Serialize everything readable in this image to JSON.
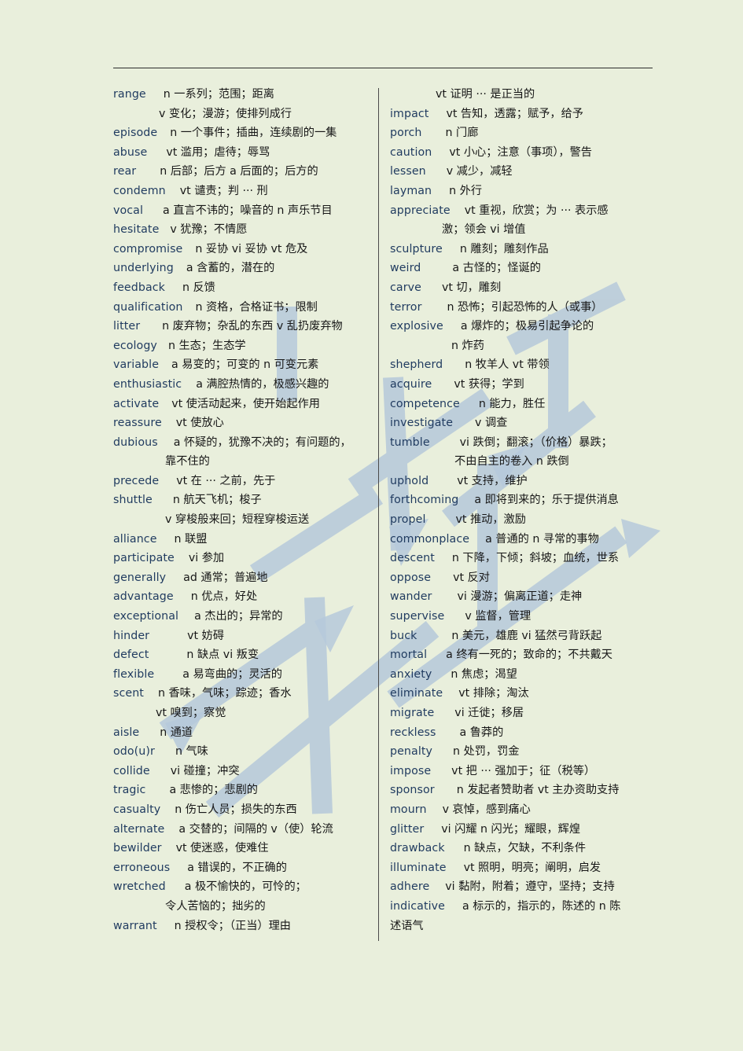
{
  "document": {
    "type": "vocabulary-glossary",
    "background_color": "#e9efdc",
    "text_color": "#171717",
    "headword_color": "#1f3a5f",
    "rule_color": "#2b2b2b",
    "watermark_color": "#b9cbdd",
    "watermark_text": "英语词汇"
  },
  "left_column": [
    {
      "word": "range",
      "gap": 22,
      "def": "n 一系列；范围；距离"
    },
    {
      "word": "",
      "gap": 58,
      "def": "v 变化；漫游；使排列成行"
    },
    {
      "word": "episode",
      "gap": 16,
      "def": "n 一个事件；插曲，连续剧的一集"
    },
    {
      "word": "abuse",
      "gap": 24,
      "def": "vt 滥用；虐待；辱骂"
    },
    {
      "word": "rear",
      "gap": 30,
      "def": "n 后部；后方 a 后面的；后方的"
    },
    {
      "word": "condemn",
      "gap": 18,
      "def": "vt 谴责；判 ··· 刑"
    },
    {
      "word": "vocal",
      "gap": 25,
      "def": "a 直言不讳的；噪音的 n 声乐节目"
    },
    {
      "word": "hesitate",
      "gap": 14,
      "def": "v 犹豫；不情愿"
    },
    {
      "word": "compromise",
      "gap": 16,
      "def": "n 妥协 vi 妥协 vt 危及"
    },
    {
      "word": "underlying",
      "gap": 16,
      "def": "a 含蓄的，潜在的"
    },
    {
      "word": "feedback",
      "gap": 22,
      "def": "n 反馈"
    },
    {
      "word": "qualification",
      "gap": 16,
      "def": "n 资格，合格证书；限制"
    },
    {
      "word": "litter",
      "gap": 28,
      "def": "n 废弃物；杂乱的东西 v 乱扔废弃物"
    },
    {
      "word": "ecology",
      "gap": 14,
      "def": "n 生态；生态学"
    },
    {
      "word": "variable",
      "gap": 16,
      "def": "a 易变的；可变的 n 可变元素"
    },
    {
      "word": "enthusiastic",
      "gap": 18,
      "def": "a 满腔热情的，极感兴趣的"
    },
    {
      "word": "activate",
      "gap": 16,
      "def": "vt 使活动起来，使开始起作用"
    },
    {
      "word": "reassure",
      "gap": 18,
      "def": "vt 使放心"
    },
    {
      "word": "dubious",
      "gap": 20,
      "def": "a 怀疑的，犹豫不决的；有问题的，"
    },
    {
      "word": "",
      "gap": 66,
      "def": "靠不住的"
    },
    {
      "word": "precede",
      "gap": 22,
      "def": "vt 在 ··· 之前，先于"
    },
    {
      "word": "shuttle",
      "gap": 26,
      "def": "n 航天飞机；梭子"
    },
    {
      "word": "",
      "gap": 66,
      "def": "v 穿梭般来回；短程穿梭运送"
    },
    {
      "word": "alliance",
      "gap": 22,
      "def": "n 联盟"
    },
    {
      "word": "participate",
      "gap": 18,
      "def": "vi 参加"
    },
    {
      "word": "generally",
      "gap": 22,
      "def": "ad 通常；普遍地"
    },
    {
      "word": "advantage",
      "gap": 22,
      "def": "n 优点，好处"
    },
    {
      "word": "exceptional",
      "gap": 20,
      "def": "a 杰出的；异常的"
    },
    {
      "word": "hinder",
      "gap": 48,
      "def": "vt 妨碍"
    },
    {
      "word": "defect",
      "gap": 48,
      "def": "n 缺点 vi 叛变"
    },
    {
      "word": "flexible",
      "gap": 36,
      "def": "a 易弯曲的；灵活的"
    },
    {
      "word": "scent",
      "gap": 18,
      "def": "n 香味，气味；踪迹；香水"
    },
    {
      "word": "",
      "gap": 54,
      "def": "vt 嗅到；察觉"
    },
    {
      "word": "aisle",
      "gap": 26,
      "def": "n 通道"
    },
    {
      "word": "odo(u)r",
      "gap": 26,
      "def": "n 气味"
    },
    {
      "word": "collide",
      "gap": 26,
      "def": "vi 碰撞；冲突"
    },
    {
      "word": "tragic",
      "gap": 30,
      "def": "a 悲惨的；悲剧的"
    },
    {
      "word": "casualty",
      "gap": 18,
      "def": "n 伤亡人员；损失的东西"
    },
    {
      "word": "alternate",
      "gap": 18,
      "def": "a 交替的；间隔的 v（使）轮流"
    },
    {
      "word": "bewilder",
      "gap": 18,
      "def": "vt 使迷惑，使难住"
    },
    {
      "word": "erroneous",
      "gap": 22,
      "def": "a 错误的，不正确的"
    },
    {
      "word": "wretched",
      "gap": 24,
      "def": "a 极不愉快的，可怜的；"
    },
    {
      "word": "",
      "gap": 66,
      "def": "令人苦恼的；拙劣的"
    },
    {
      "word": "warrant",
      "gap": 22,
      "def": "n 授权令；（正当）理由"
    }
  ],
  "right_column": [
    {
      "word": "",
      "gap": 58,
      "def": "vt 证明 ··· 是正当的"
    },
    {
      "word": "impact",
      "gap": 22,
      "def": "vt 告知，透露；赋予，给予"
    },
    {
      "word": "porch",
      "gap": 30,
      "def": "n 门廊"
    },
    {
      "word": "caution",
      "gap": 22,
      "def": "vt 小心；注意（事项），警告"
    },
    {
      "word": "lessen",
      "gap": 26,
      "def": "v 减少，减轻"
    },
    {
      "word": "layman",
      "gap": 22,
      "def": "n 外行"
    },
    {
      "word": "appreciate",
      "gap": 18,
      "def": "vt 重视，欣赏；为 ··· 表示感"
    },
    {
      "word": "",
      "gap": 66,
      "def": "激；领会 vi 增值"
    },
    {
      "word": "sculpture",
      "gap": 22,
      "def": "n 雕刻；雕刻作品"
    },
    {
      "word": "weird",
      "gap": 40,
      "def": "a 古怪的；怪诞的"
    },
    {
      "word": "carve",
      "gap": 26,
      "def": "vt 切，雕刻"
    },
    {
      "word": "terror",
      "gap": 32,
      "def": "n 恐怖；引起恐怖的人（或事）"
    },
    {
      "word": "explosive",
      "gap": 22,
      "def": "a 爆炸的；极易引起争论的"
    },
    {
      "word": "",
      "gap": 78,
      "def": "n 炸药"
    },
    {
      "word": "shepherd",
      "gap": 28,
      "def": "n 牧羊人 vt 带领"
    },
    {
      "word": "acquire",
      "gap": 28,
      "def": "vt 获得；学到"
    },
    {
      "word": "competence",
      "gap": 24,
      "def": "n 能力，胜任"
    },
    {
      "word": "investigate",
      "gap": 28,
      "def": "v 调查"
    },
    {
      "word": "tumble",
      "gap": 38,
      "def": "vi 跌倒；翻滚；（价格）暴跌；"
    },
    {
      "word": "",
      "gap": 82,
      "def": "不由自主的卷入 n 跌倒"
    },
    {
      "word": "uphold",
      "gap": 36,
      "def": "vt 支持，维护"
    },
    {
      "word": "forthcoming",
      "gap": 20,
      "def": "a 即将到来的；乐于提供消息"
    },
    {
      "word": "propel",
      "gap": 38,
      "def": "vt 推动，激励"
    },
    {
      "word": "commonplace",
      "gap": 20,
      "def": "a 普通的 n 寻常的事物"
    },
    {
      "word": "descent",
      "gap": 22,
      "def": "n 下降，下倾；斜坡；血统，世系"
    },
    {
      "word": "oppose",
      "gap": 28,
      "def": "vt 反对"
    },
    {
      "word": "wander",
      "gap": 32,
      "def": "vi 漫游；偏离正道；走神"
    },
    {
      "word": "supervise",
      "gap": 26,
      "def": "v 监督，管理"
    },
    {
      "word": "buck",
      "gap": 44,
      "def": "n 美元，雄鹿 vi 猛然弓背跃起"
    },
    {
      "word": "mortal",
      "gap": 24,
      "def": "a 终有一死的；致命的；不共戴天"
    },
    {
      "word": "anxiety",
      "gap": 24,
      "def": "n 焦虑；渴望"
    },
    {
      "word": "eliminate",
      "gap": 20,
      "def": "vt 排除；淘汰"
    },
    {
      "word": "migrate",
      "gap": 26,
      "def": "vi 迁徙；移居"
    },
    {
      "word": "reckless",
      "gap": 30,
      "def": "a 鲁莽的"
    },
    {
      "word": "penalty",
      "gap": 26,
      "def": "n 处罚，罚金"
    },
    {
      "word": "impose",
      "gap": 26,
      "def": "vt 把 ··· 强加于；征（税等）"
    },
    {
      "word": "sponsor",
      "gap": 28,
      "def": "n 发起者赞助者 vt 主办资助支持"
    },
    {
      "word": "mourn",
      "gap": 20,
      "def": "v 哀悼，感到痛心"
    },
    {
      "word": "glitter",
      "gap": 22,
      "def": "vi 闪耀 n 闪光；耀眼，辉煌"
    },
    {
      "word": "drawback",
      "gap": 24,
      "def": "n 缺点，欠缺，不利条件"
    },
    {
      "word": "illuminate",
      "gap": 22,
      "def": "vt 照明，明亮；阐明，启发"
    },
    {
      "word": "adhere",
      "gap": 20,
      "def": "vi 黏附，附着；遵守，坚持；支持"
    },
    {
      "word": "indicative",
      "gap": 22,
      "def": "a 标示的，指示的，陈述的 n 陈"
    },
    {
      "word": "",
      "gap": 0,
      "def": "述语气"
    }
  ]
}
